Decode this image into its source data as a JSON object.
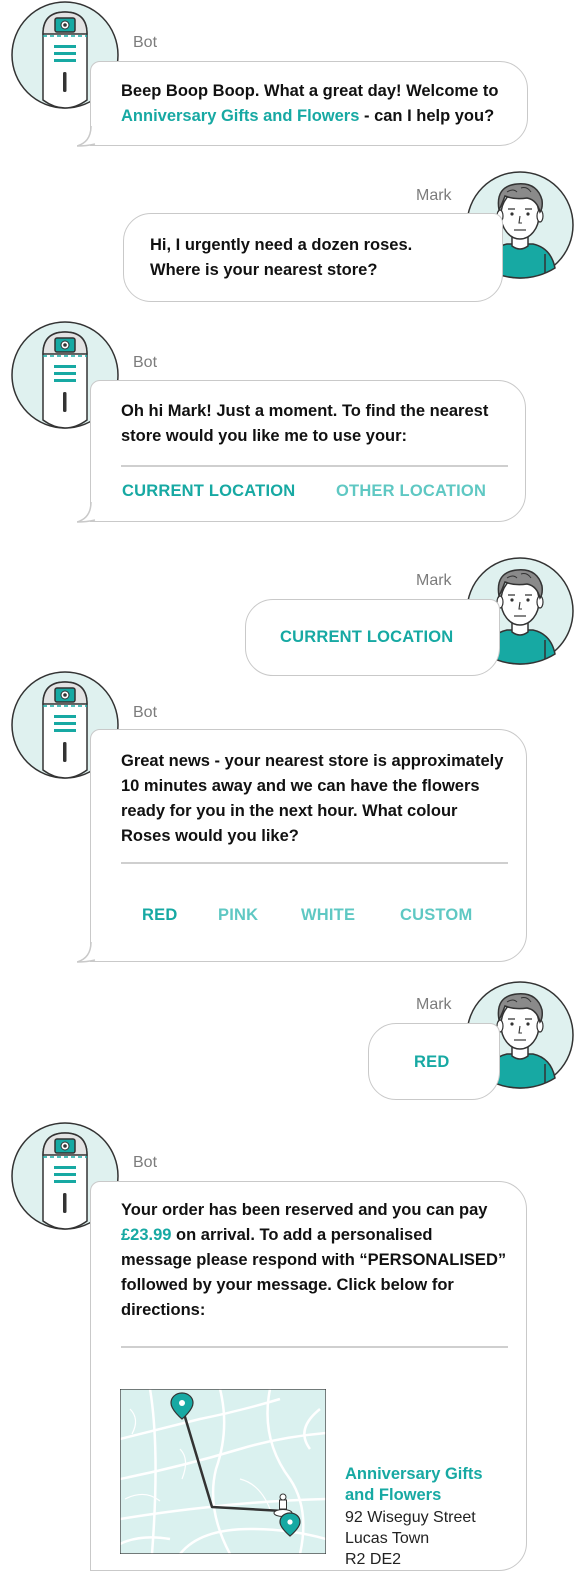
{
  "colors": {
    "teal": "#17a9a3",
    "light_teal": "#5fc8c3",
    "avatar_bg": "#dff1ef",
    "border": "#c9c9c9"
  },
  "messages": [
    {
      "sender": "Bot",
      "text_a": "Beep Boop Boop. What a great day! Welcome to",
      "link": "Anniversary Gifts and Flowers",
      "text_b": " - can I help you?"
    },
    {
      "sender": "Mark",
      "line1": "Hi, I urgently need a dozen roses.",
      "line2": "Where is your nearest store?"
    },
    {
      "sender": "Bot",
      "line1": "Oh hi Mark! Just a moment. To find the nearest",
      "line2": "store would you like me to use your:",
      "options": [
        "CURRENT LOCATION",
        "OTHER LOCATION"
      ]
    },
    {
      "sender": "Mark",
      "reply": "CURRENT LOCATION"
    },
    {
      "sender": "Bot",
      "line1": "Great news - your nearest store is approximately",
      "line2": "10 minutes away and we can have the flowers",
      "line3": "ready for you in the next hour. What colour",
      "line4": "Roses would you like?",
      "options": [
        "RED",
        "PINK",
        "WHITE",
        "CUSTOM"
      ]
    },
    {
      "sender": "Mark",
      "reply": "RED"
    },
    {
      "sender": "Bot",
      "line1": "Your order has been reserved and you can pay",
      "price": "£23.99",
      "line2_rest": " on arrival. To add a personalised",
      "line3": "message please respond with “PERSONALISED”",
      "line4": "followed by your message. Click below for",
      "line5": "directions:",
      "store": {
        "name_line1": "Anniversary Gifts",
        "name_line2": "and Flowers",
        "street": "92 Wiseguy Street",
        "town": "Lucas Town",
        "postcode": "R2 DE2"
      }
    }
  ]
}
